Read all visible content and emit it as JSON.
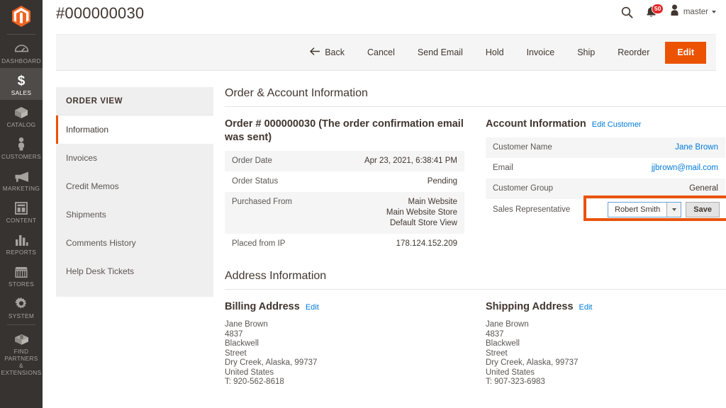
{
  "nav": {
    "logo_icon": "magento-logo-icon",
    "items": [
      {
        "label": "DASHBOARD",
        "icon": "dashboard-icon",
        "active": false
      },
      {
        "label": "SALES",
        "icon": "dollar-icon",
        "active": true
      },
      {
        "label": "CATALOG",
        "icon": "box-icon",
        "active": false
      },
      {
        "label": "CUSTOMERS",
        "icon": "person-icon",
        "active": false
      },
      {
        "label": "MARKETING",
        "icon": "megaphone-icon",
        "active": false
      },
      {
        "label": "CONTENT",
        "icon": "layout-icon",
        "active": false
      },
      {
        "label": "REPORTS",
        "icon": "bar-chart-icon",
        "active": false
      },
      {
        "label": "STORES",
        "icon": "storefront-icon",
        "active": false
      },
      {
        "label": "SYSTEM",
        "icon": "gear-icon",
        "active": false
      },
      {
        "label": "FIND PARTNERS\n& EXTENSIONS",
        "icon": "partners-box-icon",
        "active": false
      }
    ]
  },
  "header": {
    "title": "#000000030",
    "search_icon": "search-icon",
    "notifications_icon": "bell-icon",
    "notifications_count": "50",
    "avatar_icon": "user-avatar-icon",
    "user_name": "master"
  },
  "toolbar": {
    "back_label": "Back",
    "back_icon": "arrow-left-icon",
    "buttons": [
      "Cancel",
      "Send Email",
      "Hold",
      "Invoice",
      "Ship",
      "Reorder"
    ],
    "primary_label": "Edit",
    "primary_color": "#eb5202"
  },
  "order_view": {
    "title": "ORDER VIEW",
    "items": [
      {
        "label": "Information",
        "current": true
      },
      {
        "label": "Invoices",
        "current": false
      },
      {
        "label": "Credit Memos",
        "current": false
      },
      {
        "label": "Shipments",
        "current": false
      },
      {
        "label": "Comments History",
        "current": false
      },
      {
        "label": "Help Desk Tickets",
        "current": false
      }
    ]
  },
  "order_account": {
    "section_title": "Order & Account Information",
    "order": {
      "heading": "Order # 000000030 (The order confirmation email was sent)",
      "rows": [
        {
          "label": "Order Date",
          "value": "Apr 23, 2021, 6:38:41 PM"
        },
        {
          "label": "Order Status",
          "value": "Pending"
        },
        {
          "label": "Purchased From",
          "value": "Main Website\nMain Website Store\nDefault Store View"
        },
        {
          "label": "Placed from IP",
          "value": "178.124.152.209"
        }
      ]
    },
    "account": {
      "heading": "Account Information",
      "edit_link": "Edit Customer",
      "customer_name_label": "Customer Name",
      "customer_name_value": "Jane Brown",
      "email_label": "Email",
      "email_value": "jjbrown@mail.com",
      "group_label": "Customer Group",
      "group_value": "General",
      "sales_rep_label": "Sales Representative",
      "sales_rep_value": "Robert Smith",
      "save_label": "Save",
      "highlight_color": "#e8530d"
    }
  },
  "address": {
    "section_title": "Address Information",
    "billing": {
      "heading": "Billing Address",
      "edit_link": "Edit",
      "lines": [
        "Jane Brown",
        "4837",
        "Blackwell",
        "Street",
        "Dry Creek, Alaska, 99737",
        "United States",
        "T: 920-562-8618"
      ]
    },
    "shipping": {
      "heading": "Shipping Address",
      "edit_link": "Edit",
      "lines": [
        "Jane Brown",
        "4837",
        "Blackwell",
        "Street",
        "Dry Creek, Alaska, 99737",
        "United States",
        "T: 907-323-6983"
      ]
    }
  }
}
